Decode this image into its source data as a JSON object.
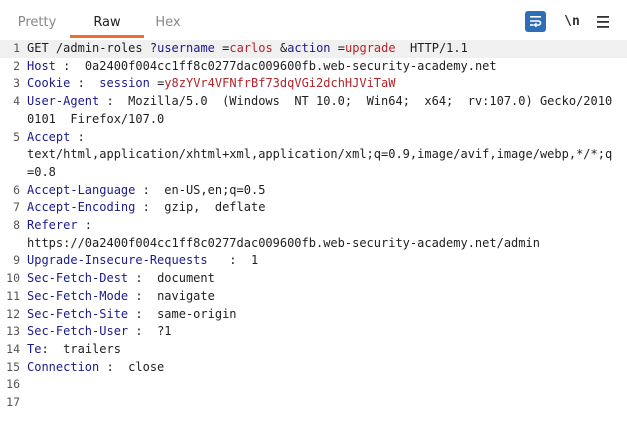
{
  "tabs": {
    "pretty": "Pretty",
    "raw": "Raw",
    "hex": "Hex",
    "active": "raw"
  },
  "toolbar": {
    "wrap_icon": "wrap-lines-icon",
    "newline_label": "\\n",
    "menu_icon": "hamburger-menu-icon"
  },
  "colors": {
    "accent": "#ef6c32",
    "header_name": "#1a1a8c",
    "param_value": "#b3242a",
    "toggle_bg": "#2f6db5"
  },
  "request": {
    "method": "GET",
    "path": "/admin-roles",
    "qmark": "?",
    "param1_name": "username",
    "eq": "=",
    "param1_value": "carlos",
    "amp": "&",
    "param2_name": "action",
    "param2_value": "upgrade",
    "protocol": "HTTP/1.1"
  },
  "headers": {
    "host_name": "Host",
    "host_value": "0a2400f004cc1ff8c0277dac009600fb.web-security-academy.net",
    "cookie_name": "Cookie",
    "cookie_key": "session",
    "cookie_value": "y8zYVr4VFNfrBf73dqVGi2dchHJViTaW",
    "ua_name": "User-Agent",
    "ua_value": "Mozilla/5.0  (Windows  NT 10.0;  Win64;  x64;  rv:107.0) Gecko/20100101  Firefox/107.0",
    "accept_name": "Accept",
    "accept_value": "text/html,application/xhtml+xml,application/xml;q=0.9,image/avif,image/webp,*/*;q=0.8",
    "accept_lang_name": "Accept-Language",
    "accept_lang_value": "en-US,en;q=0.5",
    "accept_enc_name": "Accept-Encoding",
    "accept_enc_value": "gzip,  deflate",
    "referer_name": "Referer",
    "referer_value": "https://0a2400f004cc1ff8c0277dac009600fb.web-security-academy.net/admin",
    "uir_name": "Upgrade-Insecure-Requests",
    "uir_value": "1",
    "sfd_name": "Sec-Fetch-Dest",
    "sfd_value": "document",
    "sfm_name": "Sec-Fetch-Mode",
    "sfm_value": "navigate",
    "sfs_name": "Sec-Fetch-Site",
    "sfs_value": "same-origin",
    "sfu_name": "Sec-Fetch-User",
    "sfu_value": "?1",
    "te_name": "Te",
    "te_value": "trailers",
    "conn_name": "Connection",
    "conn_value": "close"
  },
  "line_numbers": [
    "1",
    "2",
    "3",
    "4",
    "5",
    "6",
    "7",
    "8",
    "9",
    "10",
    "11",
    "12",
    "13",
    "14",
    "15",
    "16",
    "17"
  ]
}
